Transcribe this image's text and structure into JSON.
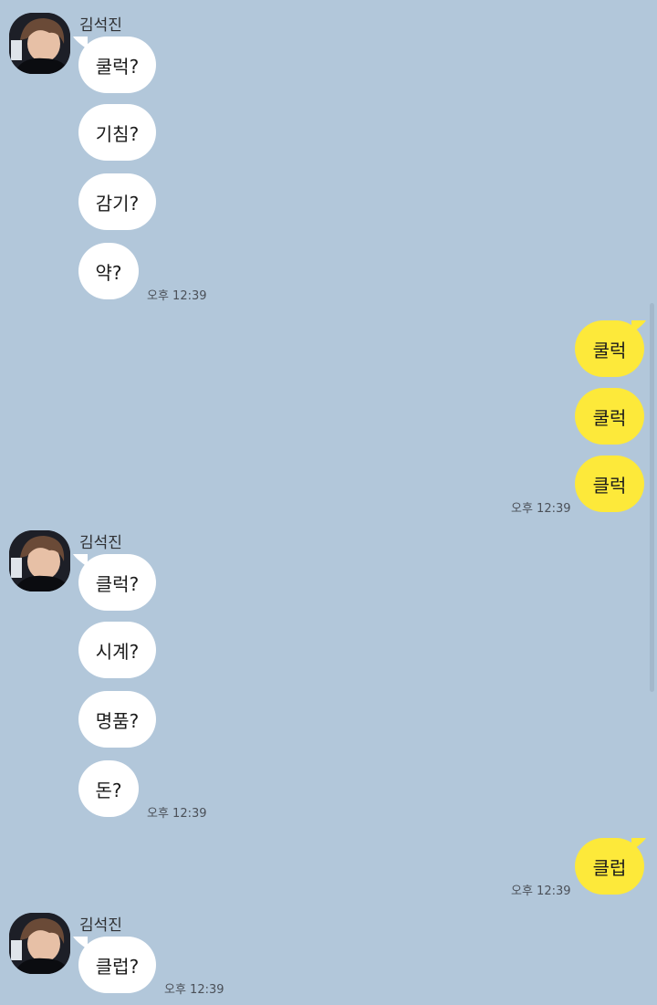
{
  "chat": {
    "messages": [
      {
        "sender": "김석진",
        "bubbles": [
          "쿨럭?",
          "기침?",
          "감기?",
          "약?"
        ],
        "time": "오후 12:39"
      },
      {
        "bubbles": [
          "쿨럭",
          "쿨럭",
          "클럭"
        ],
        "time": "오후 12:39"
      },
      {
        "sender": "김석진",
        "bubbles": [
          "클럭?",
          "시계?",
          "명품?",
          "돈?"
        ],
        "time": "오후 12:39"
      },
      {
        "bubbles": [
          "클럽"
        ],
        "time": "오후 12:39"
      },
      {
        "sender": "김석진",
        "bubbles": [
          "클럽?"
        ],
        "time": "오후 12:39"
      }
    ]
  },
  "colors": {
    "background": "#b2c7da",
    "incoming_bubble": "#ffffff",
    "outgoing_bubble": "#fde93a"
  },
  "icons": {
    "avatar": "profile-photo"
  }
}
